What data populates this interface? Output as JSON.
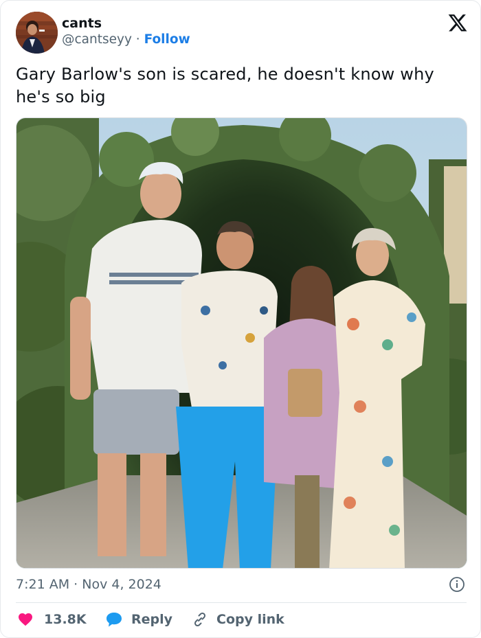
{
  "author": {
    "display_name": "cants",
    "handle": "@cantseyy",
    "separator": "·",
    "follow_label": "Follow"
  },
  "tweet": {
    "text": "Gary Barlow's son is scared, he doesn't know why he's so big",
    "time": "7:21 AM",
    "dot": "·",
    "date": "Nov 4, 2024"
  },
  "actions": {
    "like_count": "13.8K",
    "reply_label": "Reply",
    "copy_link_label": "Copy link"
  },
  "colors": {
    "like": "#f91880",
    "reply": "#1d9bf0",
    "link": "#1d7ee6",
    "muted": "#536471",
    "text": "#0f1419"
  },
  "icons": {
    "platform": "x-logo-icon",
    "like": "heart-icon",
    "reply": "speech-bubble-icon",
    "copy": "link-icon",
    "info": "info-icon"
  }
}
